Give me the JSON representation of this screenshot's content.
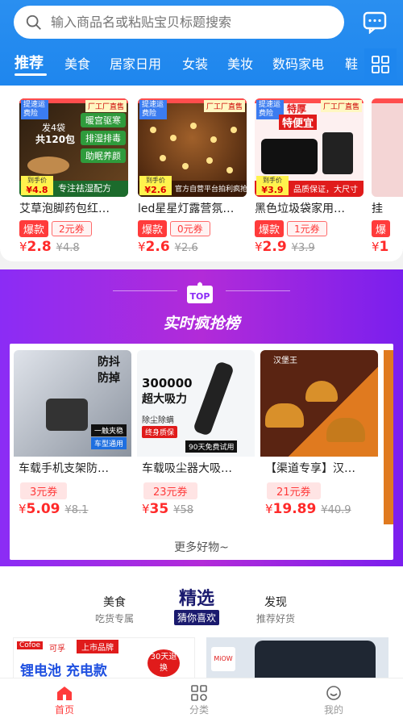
{
  "search": {
    "placeholder": "输入商品名或粘贴宝贝标题搜索"
  },
  "tabs": [
    "推荐",
    "美食",
    "居家日用",
    "女装",
    "美妆",
    "数码家电",
    "鞋"
  ],
  "section1": {
    "products": [
      {
        "name": "艾草泡脚药包红…",
        "tag": "爆款",
        "coupon": "2元券",
        "price": "2.8",
        "orig": "4.8",
        "img_text1": "发4袋",
        "img_text2": "共120包",
        "img_badge": "专注祛湿配方",
        "img_price": "4.8",
        "img_tags": [
          "暖宫驱寒",
          "排湿排毒",
          "助眠养颜"
        ]
      },
      {
        "name": "led星星灯露营氛…",
        "tag": "爆款",
        "coupon": "0元券",
        "price": "2.6",
        "orig": "2.6",
        "img_badge": "官方自营平台拍利疯抢",
        "img_price": "2.6"
      },
      {
        "name": "黑色垃圾袋家用…",
        "tag": "爆款",
        "coupon": "1元券",
        "price": "2.9",
        "orig": "3.9",
        "img_text1": "特厚",
        "img_text2": "特便宜",
        "img_badge": "品质保证，大尺寸",
        "img_price": "3.9"
      },
      {
        "name": "挂",
        "tag": "爆",
        "coupon": "",
        "price": "1",
        "orig": ""
      }
    ],
    "corner_label": "提速运费险",
    "factory_label": "厂工厂直售",
    "img_price_label": "到手价"
  },
  "section2": {
    "badge": "TOP",
    "title": "实时疯抢榜",
    "more": "更多好物~",
    "products": [
      {
        "name": "车载手机支架防…",
        "coupon": "3元券",
        "price": "5.09",
        "orig": "8.1",
        "img_text1": "防抖",
        "img_text2": "防掉",
        "img_tag1": "一触夹稳",
        "img_tag2": "车型通用"
      },
      {
        "name": "车载吸尘器大吸…",
        "coupon": "23元券",
        "price": "35",
        "orig": "58",
        "img_text1": "300000",
        "img_text2": "超大吸力",
        "img_text3": "除尘除螨",
        "img_tag1": "终身质保",
        "img_tag2": "90天免费试用"
      },
      {
        "name": "【渠道专享】汉…",
        "coupon": "21元券",
        "price": "19.89",
        "orig": "40.9",
        "img_text1": "汉堡王"
      }
    ]
  },
  "section3": {
    "cats": [
      {
        "t": "美食",
        "s": "吃货专属"
      },
      {
        "t": "精选",
        "s": "猜你喜欢"
      },
      {
        "t": "发现",
        "s": "推荐好货"
      }
    ],
    "banner1_text1": "可孚",
    "banner1_text2": "上市品牌",
    "banner1_text3": "锂电池 充电款",
    "banner1_tag": "30天退换",
    "banner2_text": "MiOW"
  },
  "tabbar": [
    {
      "label": "首页"
    },
    {
      "label": "分类"
    },
    {
      "label": "我的"
    }
  ],
  "colors": {
    "primary": "#1e86ee",
    "accent": "#ff3b3b",
    "purple": "#8b2cf5"
  }
}
